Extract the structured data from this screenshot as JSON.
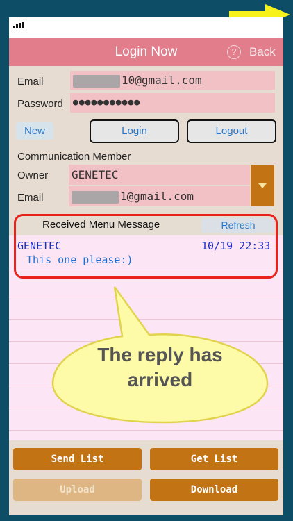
{
  "navbar": {
    "title": "Login Now",
    "help_icon": "?",
    "back_label": "Back"
  },
  "login": {
    "email_label": "Email",
    "email_value": "10@gmail.com",
    "password_label": "Password",
    "password_value": "●●●●●●●●●●●"
  },
  "actions": {
    "new_label": "New",
    "login_label": "Login",
    "logout_label": "Logout"
  },
  "member": {
    "section_label": "Communication Member",
    "owner_label": "Owner",
    "owner_value": "GENETEC",
    "email_label": "Email",
    "email_value": "1@gmail.com"
  },
  "messages": {
    "header_title": "Received Menu Message",
    "refresh_label": "Refresh",
    "items": [
      {
        "sender": "GENETEC",
        "time": "10/19 22:33",
        "body": "This one please:)"
      }
    ]
  },
  "callout": {
    "line1": "The reply has",
    "line2": "arrived"
  },
  "bottom": {
    "send_list": "Send List",
    "get_list": "Get List",
    "upload": "Upload",
    "download": "Download"
  },
  "colors": {
    "background": "#0d4e66",
    "navbar": "#e27e8c",
    "field": "#f2c1c5",
    "accent_button": "#c27414",
    "highlight_border": "#e8231e",
    "callout_fill": "#fdfaa8",
    "arrow": "#f7f21a"
  }
}
